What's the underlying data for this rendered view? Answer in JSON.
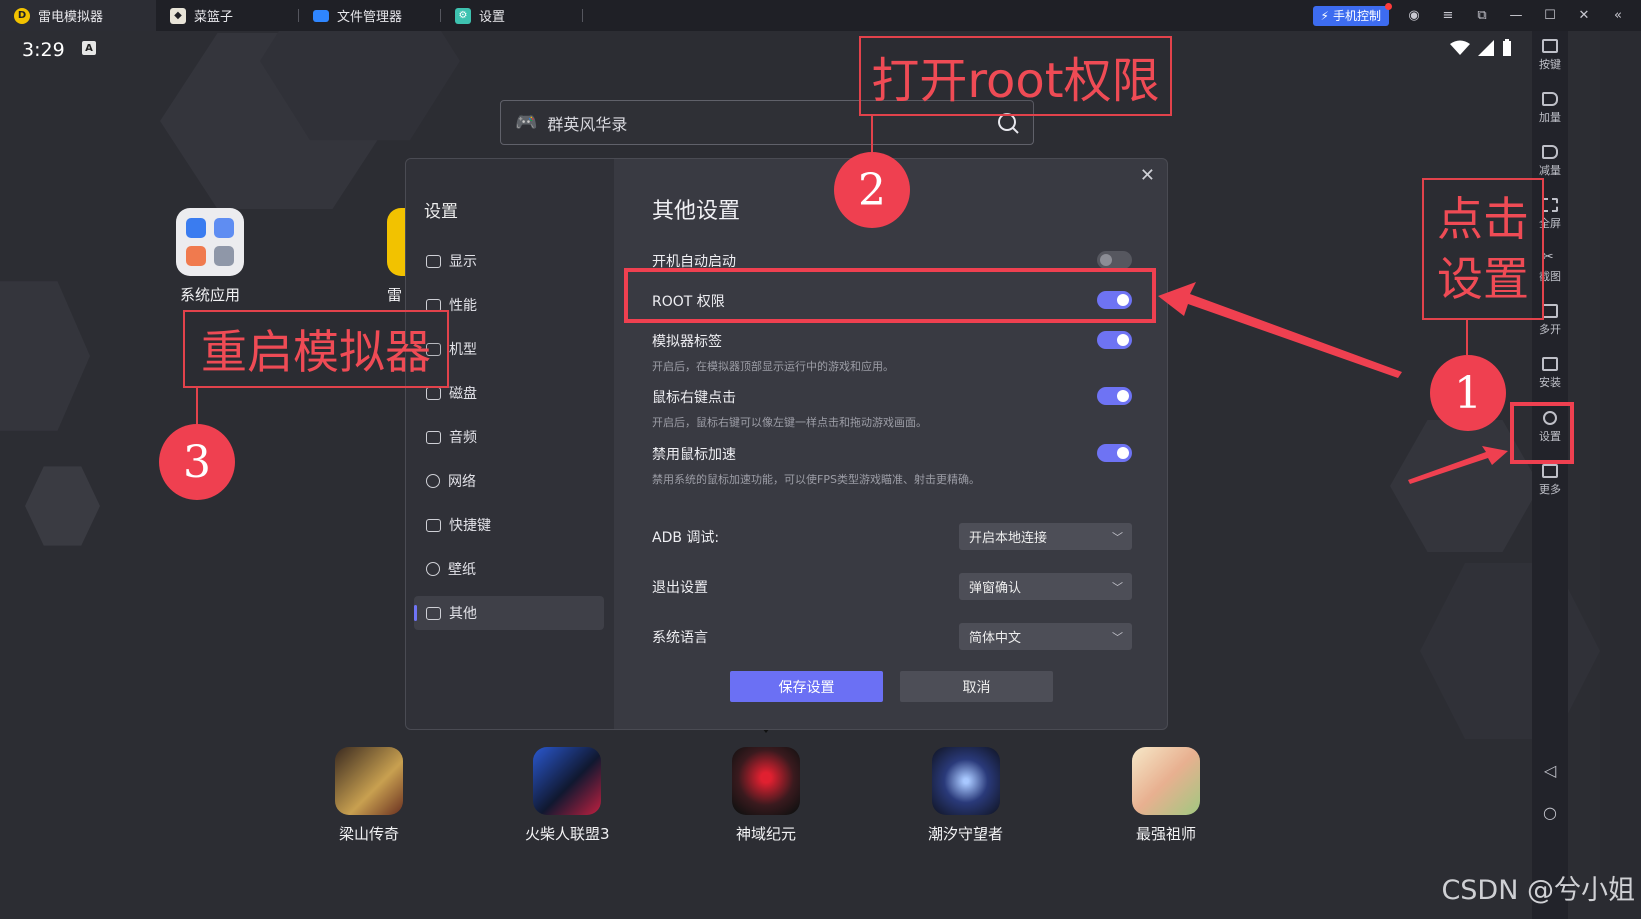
{
  "titlebar": {
    "tabs": [
      {
        "label": "雷电模拟器",
        "icon": "leidian-logo-icon",
        "color": "#f2c200"
      },
      {
        "label": "菜篮子",
        "icon": "basket-app-icon",
        "color": "#e8e4d8"
      },
      {
        "label": "文件管理器",
        "icon": "folder-icon",
        "color": "#2f86ff"
      },
      {
        "label": "设置",
        "icon": "settings-gear-icon",
        "color": "#3ec2b0"
      }
    ],
    "phone_control": "手机控制"
  },
  "status": {
    "time": "3:29",
    "badge": "A"
  },
  "search": {
    "text": "群英风华录"
  },
  "apps_top": [
    {
      "label": "系统应用"
    },
    {
      "label": "雷"
    }
  ],
  "dock": [
    {
      "label": "梁山传奇"
    },
    {
      "label": "火柴人联盟3"
    },
    {
      "label": "神域纪元"
    },
    {
      "label": "潮汐守望者"
    },
    {
      "label": "最强祖师"
    }
  ],
  "sidebar": [
    {
      "label": "按键"
    },
    {
      "label": "加量"
    },
    {
      "label": "减量"
    },
    {
      "label": "全屏"
    },
    {
      "label": "截图"
    },
    {
      "label": "多开"
    },
    {
      "label": "安装"
    },
    {
      "label": "设置"
    },
    {
      "label": "更多"
    }
  ],
  "dialog": {
    "nav_title": "设置",
    "nav": [
      {
        "label": "显示"
      },
      {
        "label": "性能"
      },
      {
        "label": "机型"
      },
      {
        "label": "磁盘"
      },
      {
        "label": "音频"
      },
      {
        "label": "网络"
      },
      {
        "label": "快捷键"
      },
      {
        "label": "壁纸"
      },
      {
        "label": "其他"
      }
    ],
    "title": "其他设置",
    "toggles": [
      {
        "label": "开机自动启动",
        "sub": "",
        "on": false
      },
      {
        "label": "ROOT 权限",
        "sub": "",
        "on": true
      },
      {
        "label": "模拟器标签",
        "sub": "开启后，在模拟器顶部显示运行中的游戏和应用。",
        "on": true
      },
      {
        "label": "鼠标右键点击",
        "sub": "开启后，鼠标右键可以像左键一样点击和拖动游戏画面。",
        "on": true
      },
      {
        "label": "禁用鼠标加速",
        "sub": "禁用系统的鼠标加速功能，可以使FPS类型游戏瞄准、射击更精确。",
        "on": true
      }
    ],
    "selects": [
      {
        "label": "ADB 调试:",
        "value": "开启本地连接"
      },
      {
        "label": "退出设置",
        "value": "弹窗确认"
      },
      {
        "label": "系统语言",
        "value": "简体中文"
      }
    ],
    "save": "保存设置",
    "cancel": "取消"
  },
  "annotations": {
    "box_root": "打开root权限",
    "box_settings_1": "点击",
    "box_settings_2": "设置",
    "box_restart": "重启模拟器",
    "n1": "1",
    "n2": "2",
    "n3": "3",
    "color": "#ef4050"
  },
  "watermark": "CSDN @兮小姐"
}
